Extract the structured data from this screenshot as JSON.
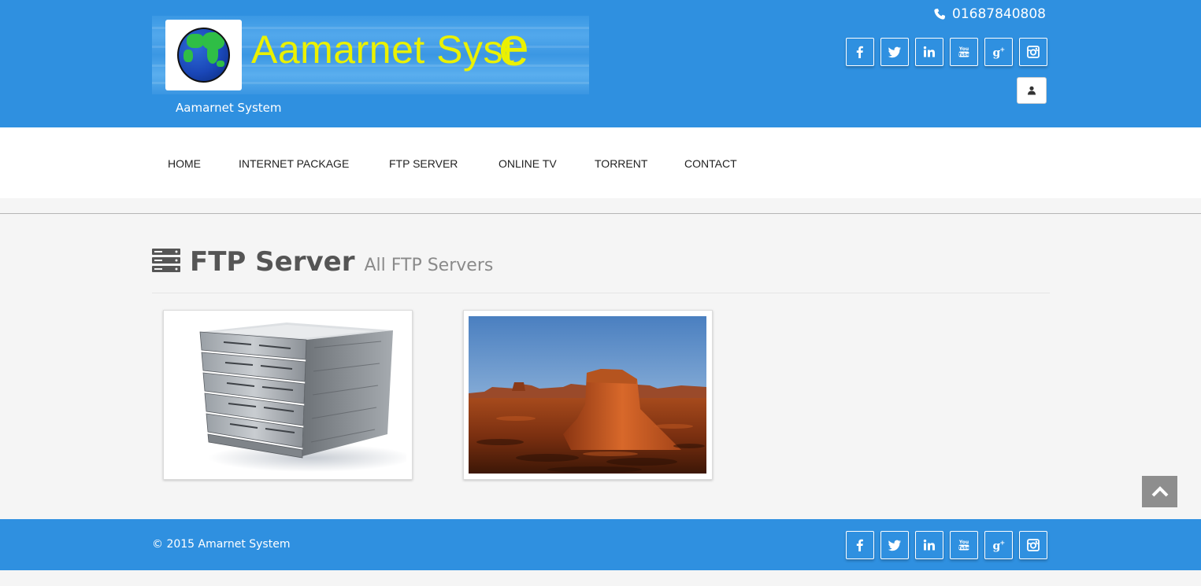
{
  "header": {
    "logo_text": "Aamarnet Syst",
    "logo_text_tail": "e",
    "site_subtitle": "Aamarnet System",
    "phone": "01687840808",
    "phone_icon": "phone-icon",
    "user_icon": "user-icon"
  },
  "social": [
    {
      "name": "facebook",
      "glyph": "f"
    },
    {
      "name": "twitter",
      "glyph": "t"
    },
    {
      "name": "linkedin",
      "glyph": "in"
    },
    {
      "name": "youtube",
      "glyph": "You Tube"
    },
    {
      "name": "google-plus",
      "glyph": "g+"
    },
    {
      "name": "instagram",
      "glyph": "ig"
    }
  ],
  "nav": {
    "items": [
      "HOME",
      "INTERNET PACKAGE",
      "FTP SERVER",
      "ONLINE TV",
      "TORRENT",
      "CONTACT"
    ]
  },
  "page": {
    "title": "FTP Server",
    "subtitle": "All FTP Servers",
    "heading_icon": "server-list-icon"
  },
  "gallery": {
    "items": [
      {
        "image": "server-rack-image"
      },
      {
        "image": "desert-mesa-image"
      }
    ]
  },
  "footer": {
    "copyright": "© 2015 Amarnet System"
  },
  "colors": {
    "brand_blue": "#2f90e0",
    "logo_yellow": "#eaf100",
    "heading_gray": "#555555"
  }
}
